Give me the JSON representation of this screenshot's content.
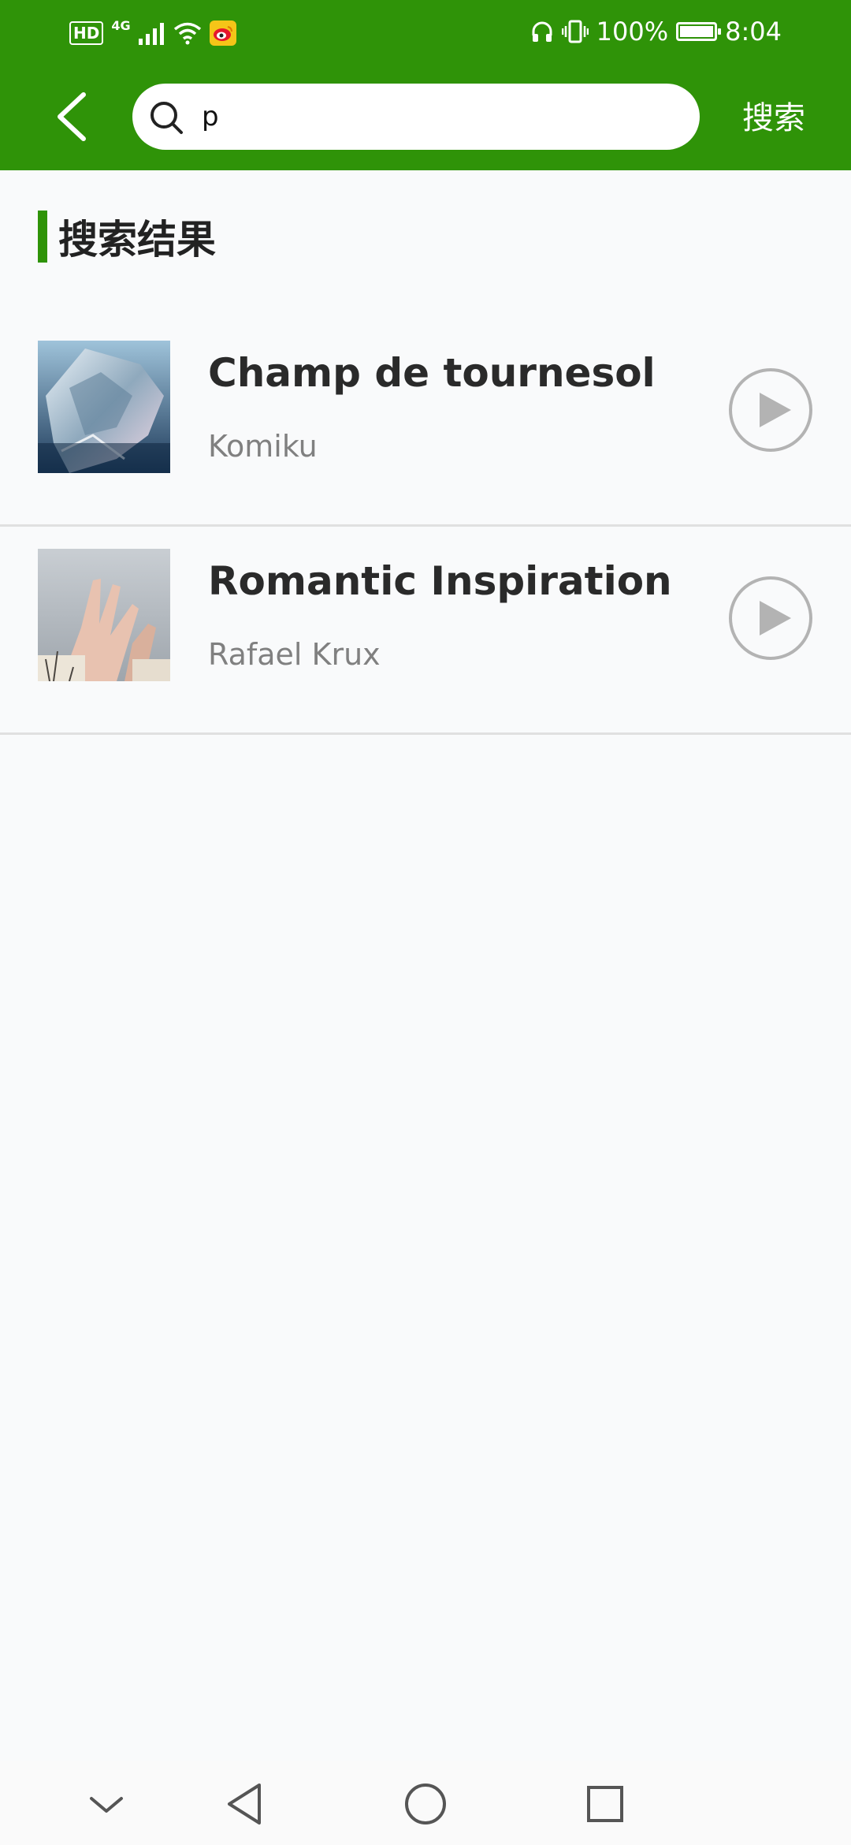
{
  "status_bar": {
    "hd": "HD",
    "network": "4G",
    "battery": "100%",
    "time": "8:04"
  },
  "header": {
    "search_value": "p",
    "search_button": "搜索"
  },
  "section": {
    "title": "搜索结果"
  },
  "results": [
    {
      "title": "Champ de tournesol",
      "artist": "Komiku",
      "thumb": "ice-crystal-image"
    },
    {
      "title": "Romantic Inspiration",
      "artist": "Rafael Krux",
      "thumb": "hands-image"
    }
  ],
  "colors": {
    "accent": "#2f9308",
    "background": "#f9fafb",
    "title_text": "#2a2a2a",
    "artist_text": "#808080"
  },
  "icons": {
    "back": "back-chevron-icon",
    "search": "search-icon",
    "play": "play-circle-icon",
    "nav": [
      "chevron-down-icon",
      "back-triangle-icon",
      "home-circle-icon",
      "recents-square-icon"
    ]
  }
}
